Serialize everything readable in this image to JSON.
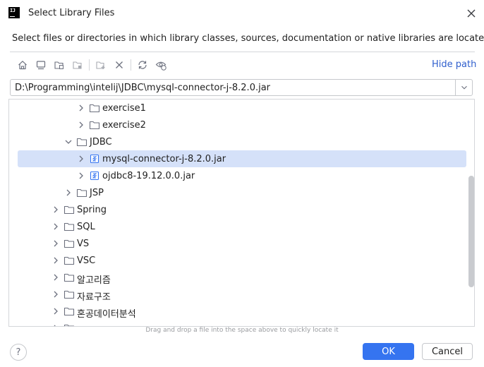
{
  "window": {
    "title": "Select Library Files",
    "app_icon_text": "IJ"
  },
  "subtitle": "Select files or directories in which library classes, sources, documentation or native libraries are located",
  "toolbar": {
    "buttons": [
      "home-icon",
      "desktop-icon",
      "project-icon",
      "module-icon",
      "new-folder-icon",
      "delete-icon",
      "refresh-icon",
      "show-hidden-icon"
    ],
    "hide_path_label": "Hide path"
  },
  "path": {
    "value": "D:\\Programming\\intelij\\JDBC\\mysql-connector-j-8.2.0.jar"
  },
  "tree": {
    "items": [
      {
        "label": "exercise1",
        "depth": 3,
        "expanded": false,
        "icon": "folder-icon",
        "selected": false
      },
      {
        "label": "exercise2",
        "depth": 3,
        "expanded": false,
        "icon": "folder-icon",
        "selected": false
      },
      {
        "label": "JDBC",
        "depth": 2,
        "expanded": true,
        "icon": "folder-icon",
        "selected": false
      },
      {
        "label": "mysql-connector-j-8.2.0.jar",
        "depth": 3,
        "expanded": false,
        "icon": "jar-icon",
        "selected": true
      },
      {
        "label": "ojdbc8-19.12.0.0.jar",
        "depth": 3,
        "expanded": false,
        "icon": "jar-icon",
        "selected": false
      },
      {
        "label": "JSP",
        "depth": 2,
        "expanded": false,
        "icon": "folder-icon",
        "selected": false
      },
      {
        "label": "Spring",
        "depth": 1,
        "expanded": false,
        "icon": "folder-icon",
        "selected": false
      },
      {
        "label": "SQL",
        "depth": 1,
        "expanded": false,
        "icon": "folder-icon",
        "selected": false
      },
      {
        "label": "VS",
        "depth": 1,
        "expanded": false,
        "icon": "folder-icon",
        "selected": false
      },
      {
        "label": "VSC",
        "depth": 1,
        "expanded": false,
        "icon": "folder-icon",
        "selected": false
      },
      {
        "label": "알고리즘",
        "depth": 1,
        "expanded": false,
        "icon": "folder-icon",
        "selected": false
      },
      {
        "label": "자료구조",
        "depth": 1,
        "expanded": false,
        "icon": "folder-icon",
        "selected": false
      },
      {
        "label": "혼공데이터분석",
        "depth": 1,
        "expanded": false,
        "icon": "folder-icon",
        "selected": false
      },
      {
        "label": "혼공머신러닝",
        "depth": 1,
        "expanded": false,
        "icon": "folder-icon",
        "selected": false
      }
    ]
  },
  "drag_hint": "Drag and drop a file into the space above to quickly locate it",
  "buttons": {
    "help": "?",
    "ok": "OK",
    "cancel": "Cancel"
  },
  "colors": {
    "accent": "#3574f0",
    "link": "#2f5fcd",
    "selection": "#d5e1f9"
  }
}
